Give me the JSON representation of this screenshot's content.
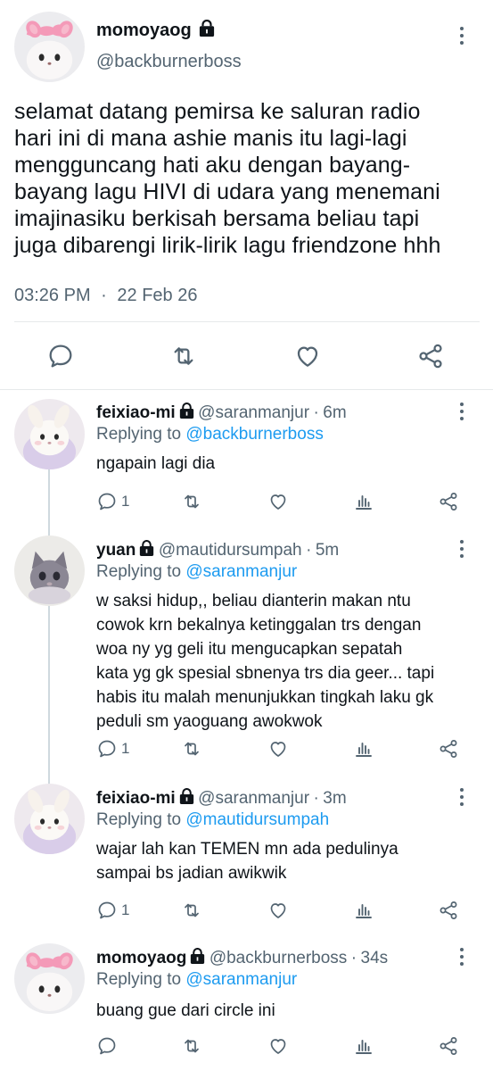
{
  "main_tweet": {
    "display_name": "momoyaog",
    "handle": "@backburnerboss",
    "text_lines": [
      "selamat datang pemirsa ke saluran radio",
      "hari ini di mana ashie manis itu lagi-lagi",
      "mengguncang hati aku dengan bayang-",
      "bayang lagu HIVI di udara yang menemani",
      "imajinasiku berkisah bersama beliau tapi",
      "juga dibarengi lirik-lirik lagu friendzone hhh"
    ],
    "time": "03:26 PM",
    "separator": "·",
    "date": "22 Feb 26"
  },
  "replies": [
    {
      "display_name": "feixiao-mi",
      "handle": "@saranmanjur",
      "age": "6m",
      "replying_prefix": "Replying to",
      "replying_to": "@backburnerboss",
      "text_lines": [
        "ngapain lagi dia"
      ],
      "reply_count": "1"
    },
    {
      "display_name": "yuan",
      "handle": "@mautidursumpah",
      "age": "5m",
      "replying_prefix": "Replying to",
      "replying_to": "@saranmanjur",
      "text_lines": [
        "w saksi hidup,, beliau dianterin makan ntu",
        "cowok krn bekalnya ketinggalan trs dengan",
        "woa ny yg geli itu mengucapkan sepatah",
        "kata yg gk spesial sbnenya trs dia geer... tapi",
        "habis itu malah menunjukkan tingkah laku gk",
        "peduli sm yaoguang awokwok"
      ],
      "reply_count": "1"
    },
    {
      "display_name": "feixiao-mi",
      "handle": "@saranmanjur",
      "age": "3m",
      "replying_prefix": "Replying to",
      "replying_to": "@mautidursumpah",
      "text_lines": [
        "wajar lah kan TEMEN mn ada pedulinya",
        "sampai bs jadian awikwik"
      ],
      "reply_count": "1"
    },
    {
      "display_name": "momoyaog",
      "handle": "@backburnerboss",
      "age": "34s",
      "replying_prefix": "Replying to",
      "replying_to": "@saranmanjur",
      "text_lines": [
        "buang gue dari circle ini"
      ],
      "reply_count": ""
    }
  ],
  "colors": {
    "text": "#0f1419",
    "secondary": "#536471",
    "link": "#1d9bf0",
    "divider": "#e6e9eb"
  },
  "icons": [
    "lock-icon",
    "more-icon",
    "reply-icon",
    "retweet-icon",
    "like-icon",
    "share-icon",
    "views-icon"
  ]
}
